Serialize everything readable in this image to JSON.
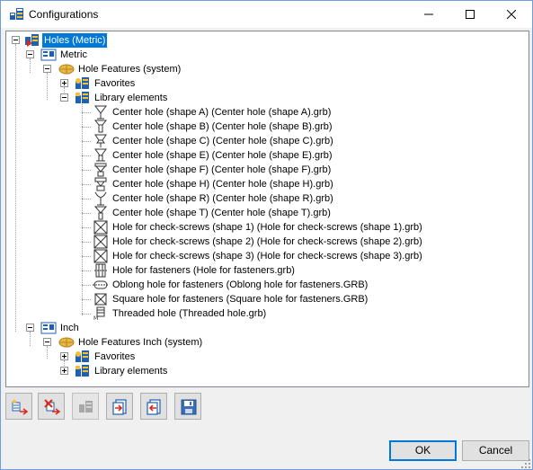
{
  "window": {
    "title": "Configurations",
    "minimize_icon": "minimize-icon",
    "maximize_icon": "maximize-icon",
    "close_icon": "close-icon"
  },
  "tree": {
    "root": "Holes (Metric)",
    "metric": "Metric",
    "metric_features": "Hole Features (system)",
    "favorites": "Favorites",
    "library": "Library elements",
    "items": [
      "Center hole (shape A) (Center hole (shape A).grb)",
      "Center hole (shape B) (Center hole (shape B).grb)",
      "Center hole (shape C) (Center hole (shape C).grb)",
      "Center hole (shape E) (Center hole (shape E).grb)",
      "Center hole (shape F) (Center hole (shape F).grb)",
      "Center hole (shape H) (Center hole (shape H).grb)",
      "Center hole (shape R) (Center hole (shape R).grb)",
      "Center hole (shape T) (Center hole (shape T).grb)",
      "Hole for check-screws (shape 1) (Hole for check-screws (shape 1).grb)",
      "Hole for check-screws (shape 2) (Hole for check-screws (shape 2).grb)",
      "Hole for check-screws (shape 3) (Hole for check-screws (shape 3).grb)",
      "Hole for fasteners (Hole for fasteners.grb)",
      "Oblong hole for fasteners (Oblong hole for fasteners.GRB)",
      "Square hole for fasteners (Square hole for fasteners.GRB)",
      "Threaded hole (Threaded hole.grb)"
    ],
    "inch": "Inch",
    "inch_features": "Hole Features Inch (system)",
    "inch_favorites": "Favorites",
    "inch_library": "Library elements"
  },
  "toolbar": {
    "buttons": [
      "new-config-icon",
      "delete-config-icon",
      "copy-config-icon",
      "export-icon",
      "import-icon",
      "save-icon"
    ]
  },
  "dialog": {
    "ok": "OK",
    "cancel": "Cancel"
  },
  "colors": {
    "selection": "#0078d7",
    "accent_blue": "#1f5fb4",
    "accent_red": "#d9281c",
    "folder_yellow": "#e9b844"
  }
}
